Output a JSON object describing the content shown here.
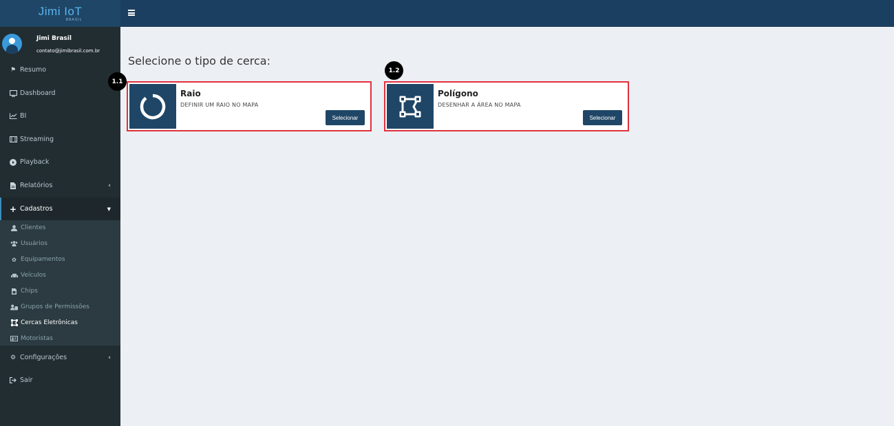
{
  "brand": {
    "logo_main": "Jimi IoT",
    "logo_sub": "BRASIL"
  },
  "user": {
    "name": "Jimi Brasil",
    "email": "contato@jimibrasil.com.br"
  },
  "sidebar": {
    "items": [
      {
        "label": "Resumo",
        "icon": "map-marked-icon"
      },
      {
        "label": "Dashboard",
        "icon": "desktop-icon"
      },
      {
        "label": "BI",
        "icon": "line-chart-icon"
      },
      {
        "label": "Streaming",
        "icon": "film-icon"
      },
      {
        "label": "Playback",
        "icon": "play-circle-icon"
      },
      {
        "label": "Relatórios",
        "icon": "file-icon"
      },
      {
        "label": "Cadastros",
        "icon": "plus-icon"
      },
      {
        "label": "Configurações",
        "icon": "cog-icon"
      },
      {
        "label": "Sair",
        "icon": "sign-out-icon"
      }
    ],
    "sub_items": [
      {
        "label": "Clientes",
        "icon": "user-icon"
      },
      {
        "label": "Usuários",
        "icon": "users-icon"
      },
      {
        "label": "Equipamentos",
        "icon": "cogs-icon"
      },
      {
        "label": "Veículos",
        "icon": "car-icon"
      },
      {
        "label": "Chips",
        "icon": "sim-card-icon"
      },
      {
        "label": "Grupos de Permissões",
        "icon": "user-group-icon"
      },
      {
        "label": "Cercas Eletrônicas",
        "icon": "draw-polygon-icon"
      },
      {
        "label": "Motoristas",
        "icon": "id-card-icon"
      }
    ]
  },
  "main": {
    "title": "Selecione o tipo de cerca:",
    "cards": [
      {
        "badge": "1.1",
        "title": "Raio",
        "description": "DEFINIR UM RAIO NO MAPA",
        "button": "Selecionar",
        "icon": "circle-notch-icon"
      },
      {
        "badge": "1.2",
        "title": "Polígono",
        "description": "DESENHAR A ÁREA NO MAPA",
        "button": "Selecionar",
        "icon": "draw-polygon-icon"
      }
    ]
  },
  "colors": {
    "header": "#1b3f60",
    "sidebar": "#222d32",
    "accent": "#1f4666",
    "highlight_border": "#e22f3c"
  }
}
